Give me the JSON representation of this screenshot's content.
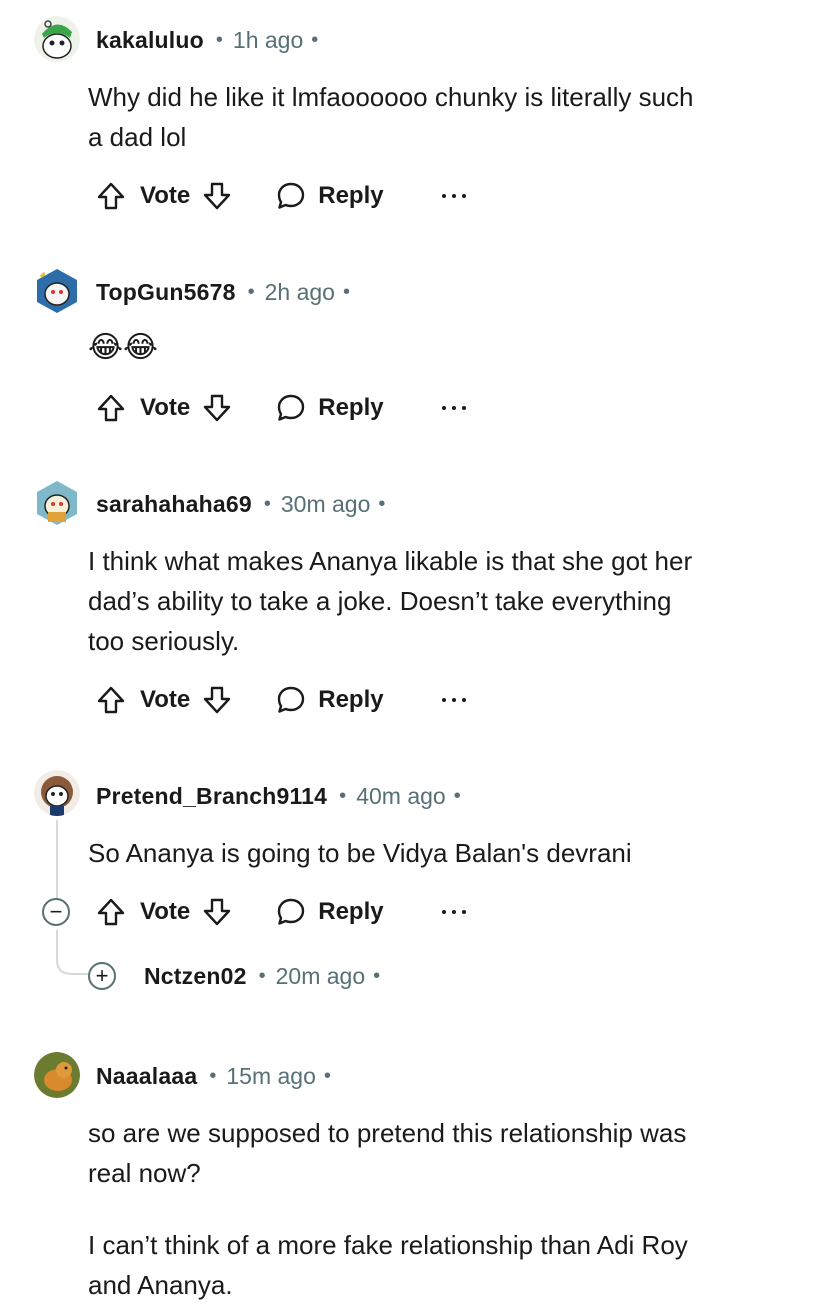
{
  "actions": {
    "vote": "Vote",
    "reply": "Reply"
  },
  "comments": [
    {
      "username": "kakaluluo",
      "time": "1h ago",
      "body": [
        "Why did he like it lmfaoooooo chunky is literally such",
        "a dad lol"
      ]
    },
    {
      "username": "TopGun5678",
      "time": "2h ago",
      "emoji": "😂😂"
    },
    {
      "username": "sarahahaha69",
      "time": "30m ago",
      "body": [
        "I think what makes Ananya likable is that she got her",
        "dad’s ability to take a joke. Doesn’t take everything",
        "too seriously."
      ]
    },
    {
      "username": "Pretend_Branch9114",
      "time": "40m ago",
      "body": [
        "So Ananya is going to be Vidya Balan's devrani"
      ]
    },
    {
      "username": "Nctzen02",
      "time": "20m ago"
    },
    {
      "username": "Naaalaaa",
      "time": "15m ago",
      "body": [
        "so are we supposed to pretend this relationship was",
        "real now?",
        "I can’t think of a more fake relationship than Adi Roy",
        "and Ananya."
      ]
    }
  ]
}
